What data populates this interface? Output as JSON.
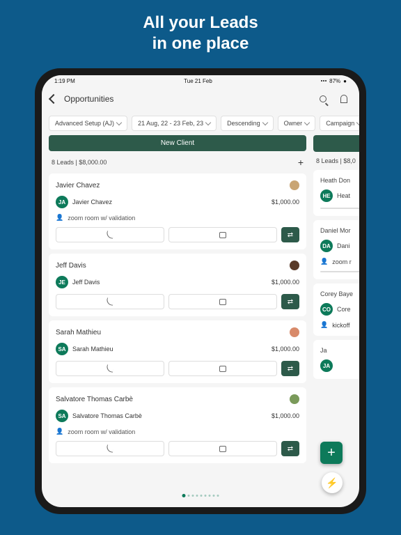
{
  "hero": {
    "line1": "All your Leads",
    "line2": "in one place"
  },
  "statusbar": {
    "time": "1:19 PM",
    "date": "Tue 21 Feb",
    "battery": "87%"
  },
  "header": {
    "title": "Opportunities"
  },
  "filters": [
    {
      "label": "Advanced Setup (AJ)"
    },
    {
      "label": "21 Aug, 22 - 23 Feb, 23"
    },
    {
      "label": "Descending"
    },
    {
      "label": "Owner"
    },
    {
      "label": "Campaign"
    }
  ],
  "column1": {
    "pill": "New Client",
    "summary": "8 Leads | $8,000.00",
    "cards": [
      {
        "name": "Javier Chavez",
        "initials": "JA",
        "contact": "Javier Chavez",
        "amount": "$1,000.00",
        "task": "zoom room w/ validation"
      },
      {
        "name": "Jeff Davis",
        "initials": "JE",
        "contact": "Jeff Davis",
        "amount": "$1,000.00",
        "task": ""
      },
      {
        "name": "Sarah Mathieu",
        "initials": "SA",
        "contact": "Sarah Mathieu",
        "amount": "$1,000.00",
        "task": ""
      },
      {
        "name": "Salvatore Thomas Carbè",
        "initials": "SA",
        "contact": "Salvatore Thomas Carbè",
        "amount": "$1,000.00",
        "task": "zoom room w/ validation"
      }
    ]
  },
  "column2": {
    "summary": "8 Leads | $8,0",
    "cards": [
      {
        "name": "Heath Don",
        "initials": "HE",
        "contact": "Heat"
      },
      {
        "name": "Daniel Mor",
        "initials": "DA",
        "contact": "Dani",
        "task": "zoom r"
      },
      {
        "name": "Corey Baye",
        "initials": "CO",
        "contact": "Core",
        "task": "kickoff"
      },
      {
        "name": "Ja",
        "initials": "JA",
        "contact": ""
      }
    ]
  },
  "avatarColors": [
    "#c9a574",
    "#5a3a28",
    "#d88a6a",
    "#7a9a5a"
  ]
}
